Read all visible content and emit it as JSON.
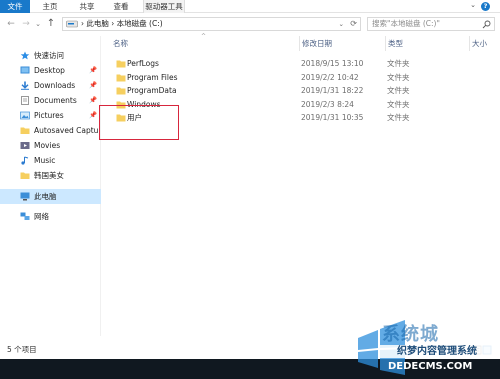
{
  "ribbon": {
    "tabs": [
      "文件",
      "主页",
      "共享",
      "查看",
      "驱动器工具"
    ],
    "help_label": "?"
  },
  "address": {
    "path": "› 此电脑 › 本地磁盘 (C:)",
    "search_placeholder": "搜索\"本地磁盘 (C:)\""
  },
  "columns": {
    "name": "名称",
    "date": "修改日期",
    "type": "类型",
    "size": "大小"
  },
  "sidebar": {
    "items": [
      {
        "label": "快速访问",
        "icon": "star-icon"
      },
      {
        "label": "Desktop",
        "icon": "desktop-icon",
        "pinned": "📌"
      },
      {
        "label": "Downloads",
        "icon": "download-icon",
        "pinned": "📌"
      },
      {
        "label": "Documents",
        "icon": "documents-icon",
        "pinned": "📌"
      },
      {
        "label": "Pictures",
        "icon": "pictures-icon",
        "pinned": "📌"
      },
      {
        "label": "Autosaved Captu",
        "icon": "folder-icon"
      },
      {
        "label": "Movies",
        "icon": "movies-icon"
      },
      {
        "label": "Music",
        "icon": "music-icon"
      },
      {
        "label": "韩国美女",
        "icon": "folder-icon"
      },
      {
        "label": "此电脑",
        "icon": "computer-icon"
      },
      {
        "label": "网络",
        "icon": "network-icon"
      }
    ]
  },
  "files": [
    {
      "name": "PerfLogs",
      "date": "2018/9/15 13:10",
      "type": "文件夹"
    },
    {
      "name": "Program Files",
      "date": "2019/2/2 10:42",
      "type": "文件夹"
    },
    {
      "name": "ProgramData",
      "date": "2019/1/31 18:22",
      "type": "文件夹"
    },
    {
      "name": "Windows",
      "date": "2019/2/3 8:24",
      "type": "文件夹"
    },
    {
      "name": "用户",
      "date": "2019/1/31 10:35",
      "type": "文件夹"
    }
  ],
  "status": {
    "count": "5 个项目"
  },
  "watermark": {
    "title": "系统城",
    "subtitle": "织梦内容管理系统",
    "url": "DEDECMS.COM"
  },
  "colors": {
    "accent": "#1979ca",
    "selected": "#cce8ff",
    "folder": "#f6cf5f",
    "highlight": "#d7263d"
  }
}
